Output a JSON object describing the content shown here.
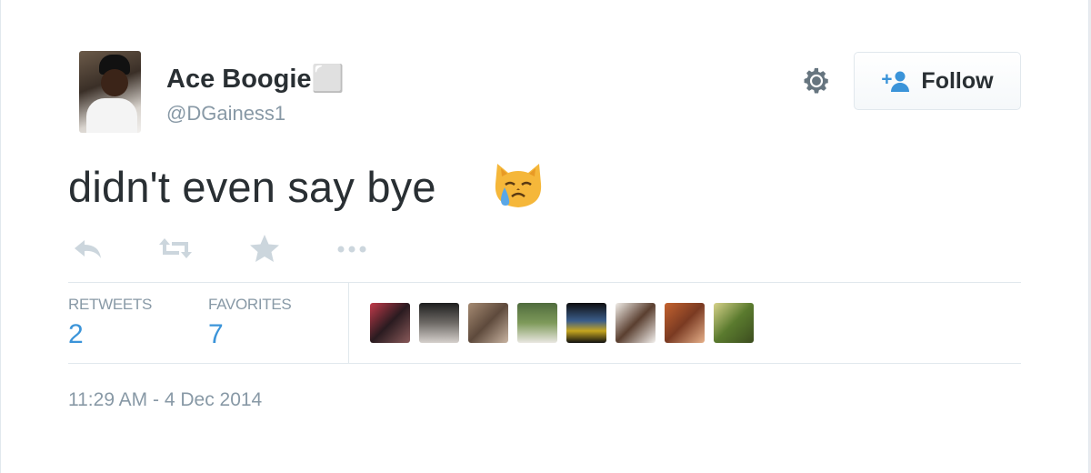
{
  "tweet": {
    "display_name": "Ace Boogie⬜",
    "handle": "@DGainess1",
    "text": "didn't even say bye",
    "timestamp": "11:29 AM - 4 Dec 2014",
    "emoji": "crying-cat-face"
  },
  "header": {
    "follow_label": "Follow",
    "settings_icon": "gear-icon",
    "follow_icon": "add-user-icon"
  },
  "actions": [
    "reply-icon",
    "retweet-icon",
    "favorite-icon",
    "more-icon"
  ],
  "stats": {
    "retweets_label": "RETWEETS",
    "retweets_count": "2",
    "favorites_label": "FAVORITES",
    "favorites_count": "7",
    "favoriter_avatars": 8
  },
  "colors": {
    "text": "#292f33",
    "muted": "#8899a6",
    "accent": "#3b94d9",
    "border": "#e1e8ed"
  }
}
